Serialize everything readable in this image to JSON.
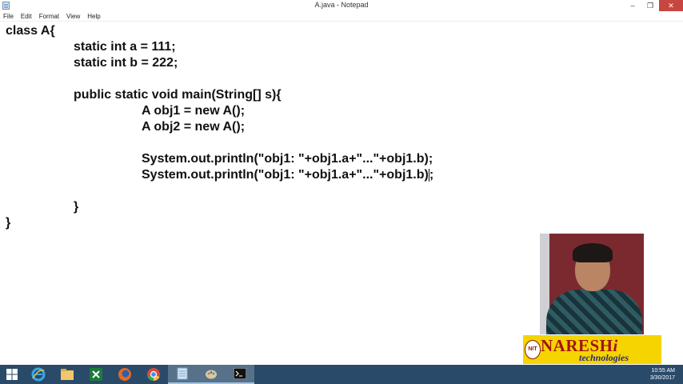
{
  "window": {
    "title": "A.java - Notepad",
    "minimize_glyph": "‒",
    "maximize_glyph": "❐",
    "close_glyph": "✕"
  },
  "menu": [
    "File",
    "Edit",
    "Format",
    "View",
    "Help"
  ],
  "code_lines": [
    "class A{",
    "static int a = 111;",
    "static int b = 222;",
    "public static void main(String[] s){",
    "A obj1 = new A();",
    "A obj2 = new A();",
    "System.out.println(\"obj1: \"+obj1.a+\"...\"+obj1.b);",
    "System.out.println(\"obj1: \"+obj1.a+\"...\"+obj1.b)",
    ";",
    "}",
    "}"
  ],
  "logo": {
    "mark": "NIT",
    "name": "NARESH",
    "name_suffix": "i",
    "tagline": "technologies"
  },
  "taskbar": {
    "icons": [
      "windows-start-icon",
      "ie-icon",
      "file-explorer-icon",
      "excel-icon",
      "firefox-icon",
      "chrome-icon",
      "notepad-icon",
      "paint-icon",
      "cmd-icon"
    ],
    "clock_time": "10:55 AM",
    "clock_date": "3/30/2017"
  },
  "colors": {
    "taskbar": "#2a4a6a",
    "logo_bg": "#f5d400",
    "logo_text": "#a31414",
    "close_button": "#c7463f"
  }
}
